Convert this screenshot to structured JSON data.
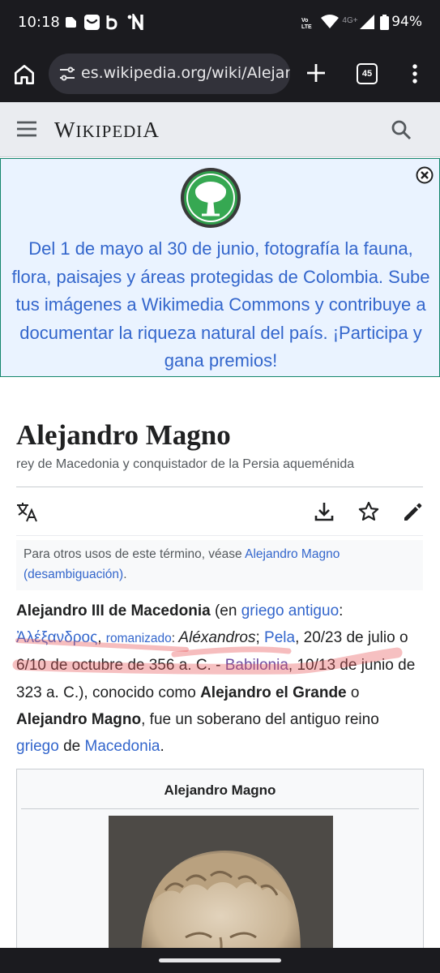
{
  "status_bar": {
    "time": "10:18",
    "notification_icons": [
      "square-icon",
      "inbox-icon",
      "b-icon",
      "n-icon"
    ],
    "network_label": "4G+",
    "lte_label": "Vo LTE",
    "battery": "94%"
  },
  "browser": {
    "url": "es.wikipedia.org/wiki/Alejandro_Magno",
    "tab_count": "45"
  },
  "wiki_header": {
    "wordmark_first": "W",
    "wordmark_mid": "IKIPEDI",
    "wordmark_last": "A"
  },
  "banner": {
    "text": "Del 1 de mayo al 30 de junio, fotografía la fauna, flora, paisajes y áreas protegidas de Colombia. Sube tus imágenes a Wikimedia Commons y contribuye a documentar la riqueza natural del país. ¡Participa y gana premios!"
  },
  "article": {
    "title": "Alejandro Magno",
    "subtitle": "rey de Macedonia y conquistador de la Persia aqueménida",
    "hatnote": {
      "prefix": "Para otros usos de este término, véase ",
      "link": "Alejandro Magno (desambiguación)",
      "suffix": "."
    },
    "lead": {
      "b1": "Alejandro III de Macedonia",
      "t1": " (en ",
      "l1": "griego antiguo",
      "t2": ": ",
      "l2": "Ἀλέξανδρος",
      "t3": ", ",
      "l3": "romanizado",
      "t4": ": ",
      "i1": "Aléxandros",
      "t5": "; ",
      "l4": "Pela",
      "t6": ", 20/23 de julio o 6/10 de octubre de 356 a. C. - ",
      "l5": "Babilonia",
      "t7": ", 10/13 de junio de 323 a. C.), conocido como ",
      "b2": "Alejandro el Grande",
      "t8": " o ",
      "b3": "Alejandro Magno",
      "t9": ", fue un soberano del antiguo reino ",
      "l6": "griego",
      "t10": " de ",
      "l7": "Macedonia",
      "t11": "."
    },
    "infobox_caption": "Alejandro Magno"
  },
  "colors": {
    "link": "#3366cc",
    "visited_link": "#6b4ba1",
    "banner_border": "#14866d",
    "banner_bg": "#eaf3ff",
    "highlight": "#e8595c"
  }
}
